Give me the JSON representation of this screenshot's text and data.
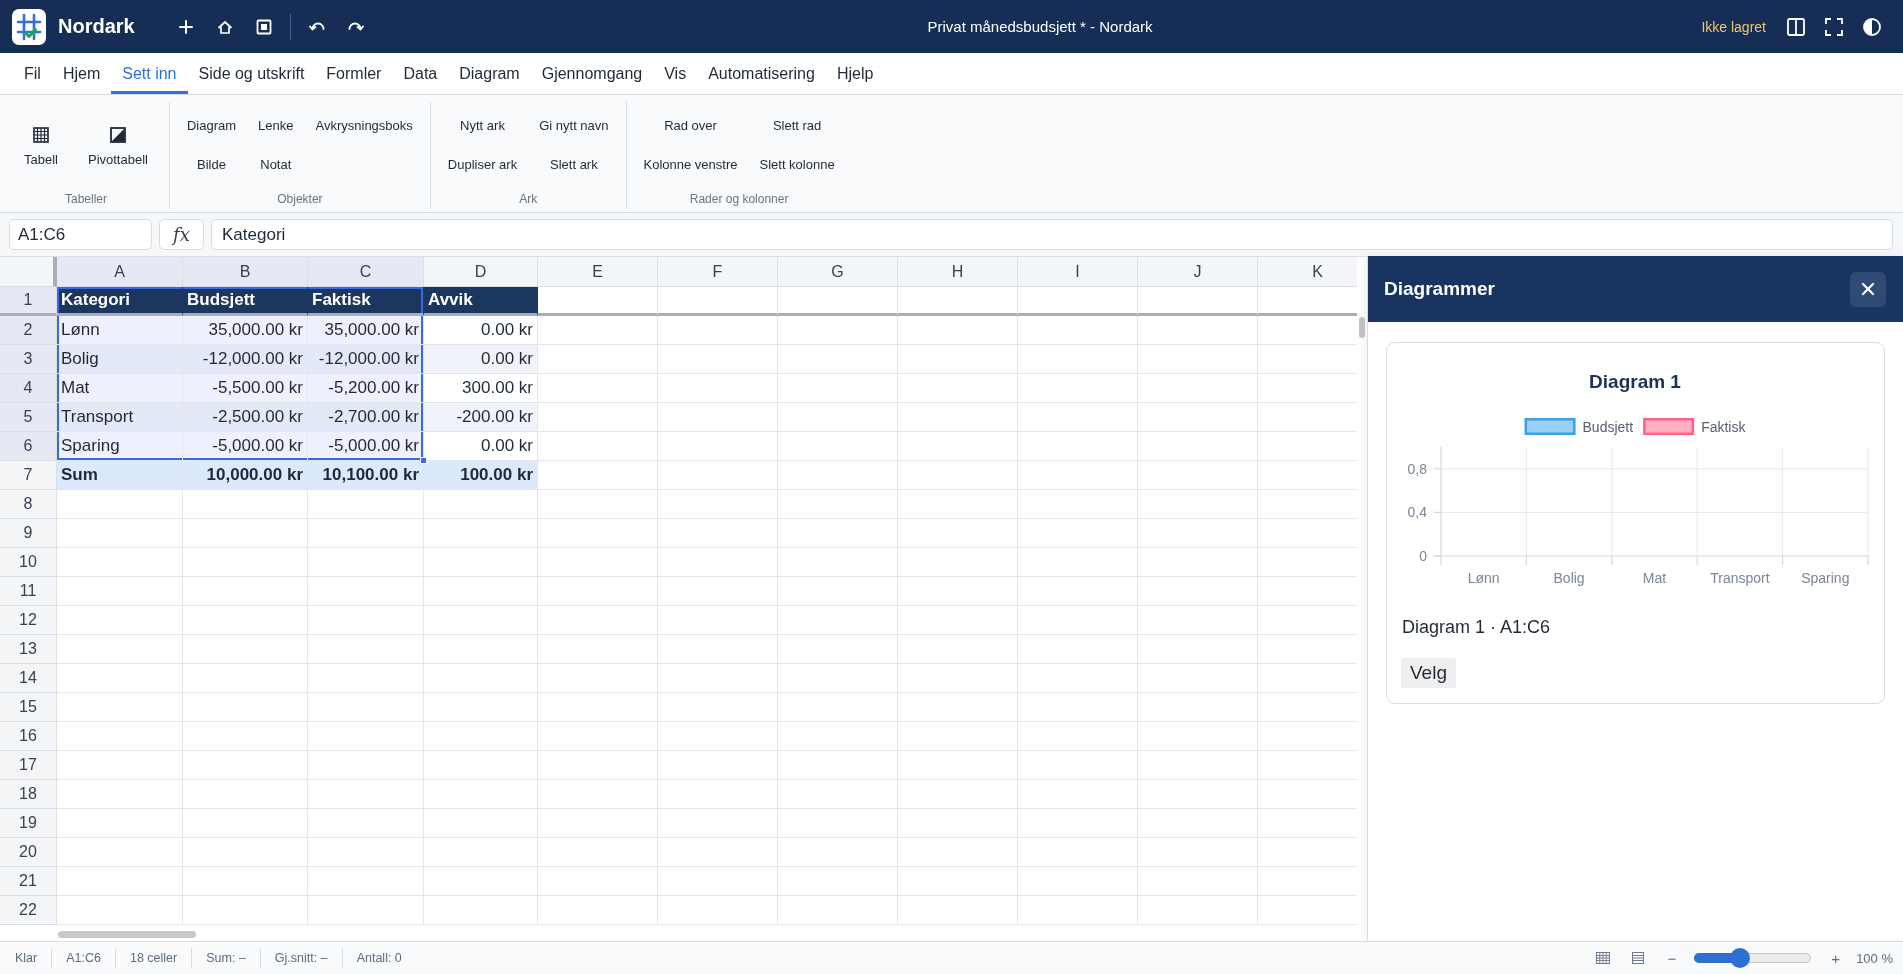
{
  "title_bar": {
    "app_name": "Nordark",
    "title": "Privat månedsbudsjett * - Nordark",
    "save_status": "Ikke lagret"
  },
  "menu_tabs": [
    {
      "label": "Fil",
      "selected": false
    },
    {
      "label": "Hjem",
      "selected": false
    },
    {
      "label": "Sett inn",
      "selected": true
    },
    {
      "label": "Side og utskrift",
      "selected": false
    },
    {
      "label": "Formler",
      "selected": false
    },
    {
      "label": "Data",
      "selected": false
    },
    {
      "label": "Diagram",
      "selected": false
    },
    {
      "label": "Gjennomgang",
      "selected": false
    },
    {
      "label": "Vis",
      "selected": false
    },
    {
      "label": "Automatisering",
      "selected": false
    },
    {
      "label": "Hjelp",
      "selected": false
    }
  ],
  "ribbon": {
    "groups": [
      {
        "label": "Tabeller",
        "kind": "large",
        "buttons": [
          "Tabell",
          "Pivottabell"
        ]
      },
      {
        "label": "Objekter",
        "kind": "grid",
        "rows": [
          [
            "Diagram",
            "Lenke",
            "Avkrysningsboks"
          ],
          [
            "Bilde",
            "Notat"
          ]
        ]
      },
      {
        "label": "Ark",
        "kind": "grid",
        "rows": [
          [
            "Nytt ark",
            "Gi nytt navn"
          ],
          [
            "Dupliser ark",
            "Slett ark"
          ]
        ]
      },
      {
        "label": "Rader og kolonner",
        "kind": "grid",
        "rows": [
          [
            "Rad over",
            "Slett rad"
          ],
          [
            "Kolonne venstre",
            "Slett kolonne"
          ]
        ]
      }
    ]
  },
  "formula_bar": {
    "name_box": "A1:C6",
    "function_label": "fx",
    "value": "Kategori"
  },
  "sheet": {
    "columns": [
      {
        "label": "A",
        "selected": true
      },
      {
        "label": "B",
        "selected": true
      },
      {
        "label": "C",
        "selected": true
      },
      {
        "label": "D",
        "selected": false
      },
      {
        "label": "E",
        "selected": false
      },
      {
        "label": "F",
        "selected": false
      },
      {
        "label": "G",
        "selected": false
      },
      {
        "label": "H",
        "selected": false
      },
      {
        "label": "I",
        "selected": false
      },
      {
        "label": "J",
        "selected": false
      },
      {
        "label": "K",
        "selected": false
      }
    ],
    "rows": [
      {
        "number": "1",
        "kind": "header",
        "selected": true,
        "cells": [
          "Kategori",
          "Budsjett",
          "Faktisk",
          "Avvik"
        ]
      },
      {
        "number": "2",
        "kind": "data",
        "selected": true,
        "cells": [
          "Lønn",
          "35,000.00 kr",
          "35,000.00 kr",
          "0.00 kr"
        ]
      },
      {
        "number": "3",
        "kind": "data",
        "selected": true,
        "cells": [
          "Bolig",
          "-12,000.00 kr",
          "-12,000.00 kr",
          "0.00 kr"
        ]
      },
      {
        "number": "4",
        "kind": "data",
        "selected": true,
        "cells": [
          "Mat",
          "-5,500.00 kr",
          "-5,200.00 kr",
          "300.00 kr"
        ]
      },
      {
        "number": "5",
        "kind": "data",
        "selected": true,
        "cells": [
          "Transport",
          "-2,500.00 kr",
          "-2,700.00 kr",
          "-200.00 kr"
        ]
      },
      {
        "number": "6",
        "kind": "data",
        "selected": true,
        "cells": [
          "Sparing",
          "-5,000.00 kr",
          "-5,000.00 kr",
          "0.00 kr"
        ]
      },
      {
        "number": "7",
        "kind": "total",
        "selected": false,
        "cells": [
          "Sum",
          "10,000.00 kr",
          "10,100.00 kr",
          "100.00 kr"
        ]
      },
      {
        "number": "8",
        "kind": "data",
        "selected": false
      },
      {
        "number": "9",
        "kind": "data",
        "selected": false
      },
      {
        "number": "10",
        "kind": "data",
        "selected": false
      },
      {
        "number": "11",
        "kind": "data",
        "selected": false
      },
      {
        "number": "12",
        "kind": "data",
        "selected": false
      },
      {
        "number": "13",
        "kind": "data",
        "selected": false
      },
      {
        "number": "14",
        "kind": "data",
        "selected": false
      },
      {
        "number": "15",
        "kind": "data",
        "selected": false
      },
      {
        "number": "16",
        "kind": "data",
        "selected": false
      },
      {
        "number": "17",
        "kind": "data",
        "selected": false
      },
      {
        "number": "18",
        "kind": "data",
        "selected": false
      },
      {
        "number": "19",
        "kind": "data",
        "selected": false
      },
      {
        "number": "20",
        "kind": "data",
        "selected": false
      },
      {
        "number": "21",
        "kind": "data",
        "selected": false
      },
      {
        "number": "22",
        "kind": "data",
        "selected": false
      }
    ]
  },
  "side_panel": {
    "title": "Diagrammer",
    "charts": [
      {
        "chart_data": {
          "type": "bar",
          "title": "Diagram 1",
          "categories": [
            "Lønn",
            "Bolig",
            "Mat",
            "Transport",
            "Sparing"
          ],
          "series": [
            {
              "name": "Budsjett",
              "color": "#36a2eb",
              "values": [
                null,
                null,
                null,
                null,
                null
              ]
            },
            {
              "name": "Faktisk",
              "color": "#ff6384",
              "values": [
                null,
                null,
                null,
                null,
                null
              ]
            }
          ],
          "ylim": [
            0,
            1
          ],
          "yticks": [
            0,
            {
              "value": 0.4,
              "label": "0,4"
            },
            {
              "value": 0.8,
              "label": "0,8"
            }
          ]
        },
        "caption": "Diagram 1 · A1:C6",
        "action": "Velg"
      }
    ]
  },
  "status_bar": {
    "items": [
      "Klar",
      "A1:C6",
      "18 celler",
      "Sum: –",
      "Gj.snitt: –",
      "Antall: 0"
    ],
    "zoom_out": "−",
    "zoom": {
      "level": 0.37
    },
    "zoom_in": "+",
    "zoom_label": "100 %"
  }
}
